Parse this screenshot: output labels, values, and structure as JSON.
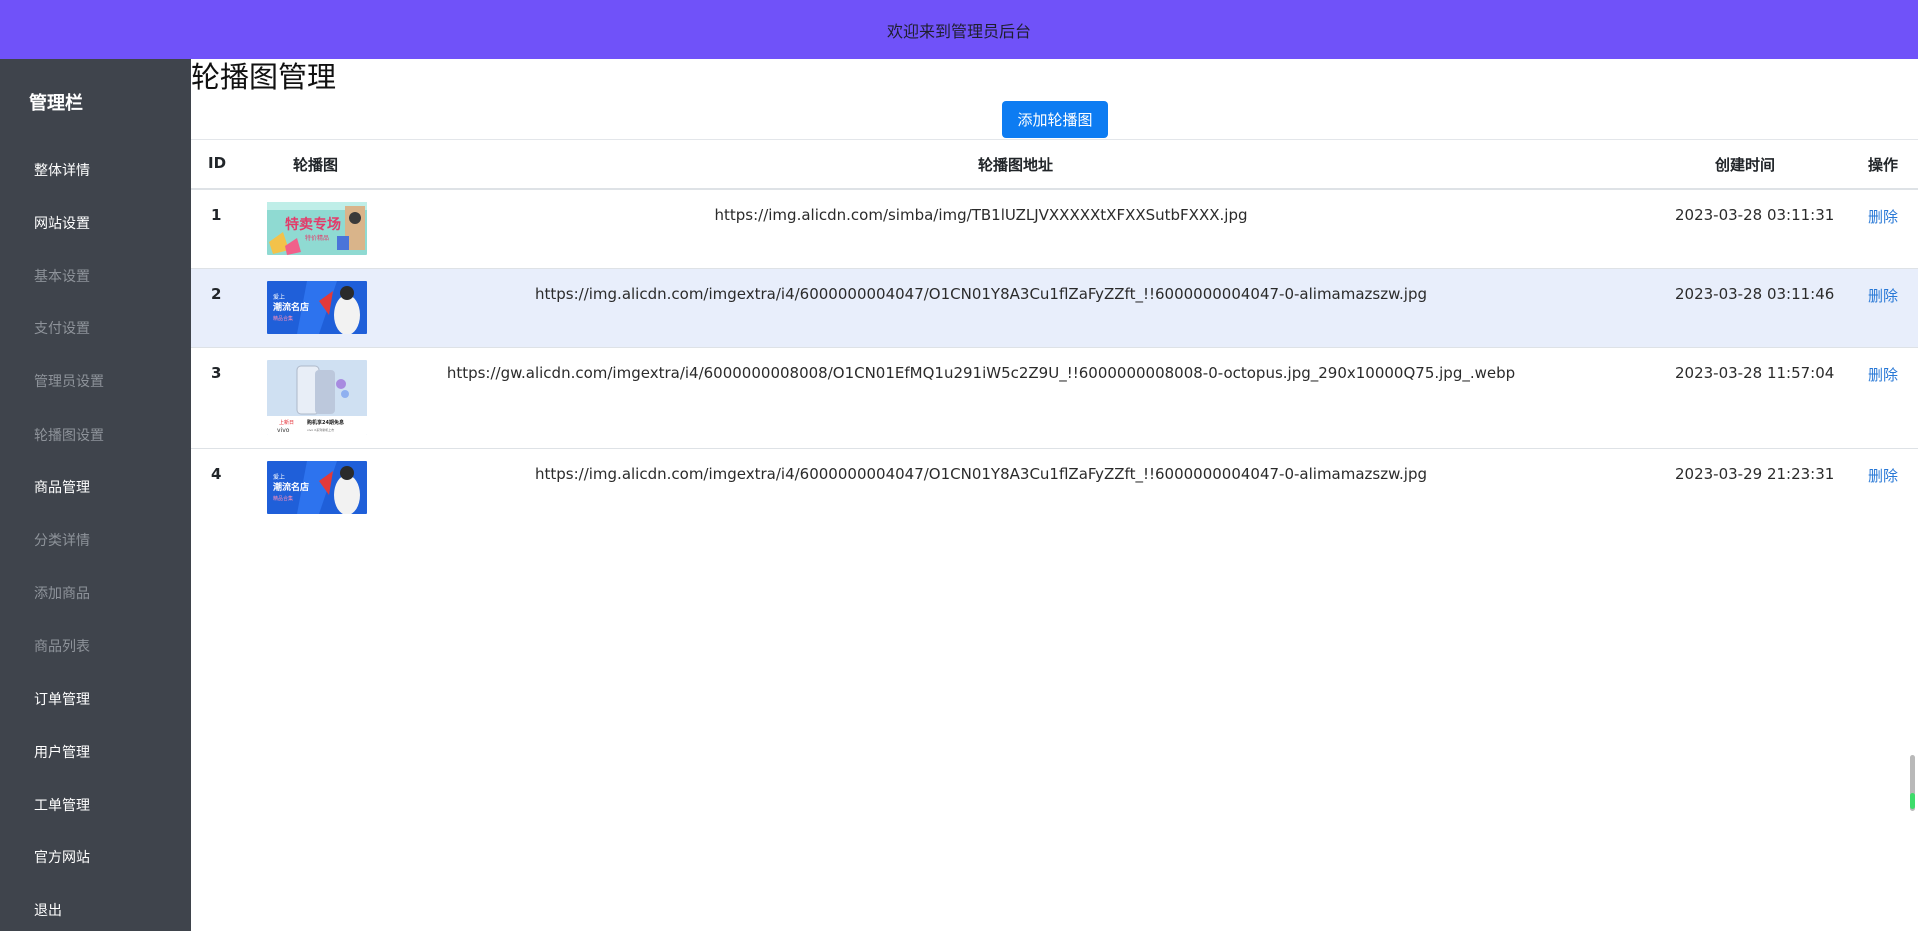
{
  "header": {
    "welcome": "欢迎来到管理员后台"
  },
  "sidebar": {
    "title": "管理栏",
    "items": [
      {
        "label": "整体详情",
        "kind": "primary"
      },
      {
        "label": "网站设置",
        "kind": "primary"
      },
      {
        "label": "基本设置",
        "kind": "sub"
      },
      {
        "label": "支付设置",
        "kind": "sub"
      },
      {
        "label": "管理员设置",
        "kind": "sub"
      },
      {
        "label": "轮播图设置",
        "kind": "sub"
      },
      {
        "label": "商品管理",
        "kind": "primary"
      },
      {
        "label": "分类详情",
        "kind": "sub"
      },
      {
        "label": "添加商品",
        "kind": "sub"
      },
      {
        "label": "商品列表",
        "kind": "sub"
      },
      {
        "label": "订单管理",
        "kind": "primary"
      },
      {
        "label": "用户管理",
        "kind": "primary"
      },
      {
        "label": "工单管理",
        "kind": "primary"
      },
      {
        "label": "官方网站",
        "kind": "primary"
      },
      {
        "label": "退出",
        "kind": "primary"
      }
    ]
  },
  "main": {
    "title": "轮播图管理",
    "add_button": "添加轮播图",
    "table": {
      "headers": {
        "id": "ID",
        "image": "轮播图",
        "url": "轮播图地址",
        "created": "创建时间",
        "action": "操作"
      },
      "rows": [
        {
          "id": "1",
          "url": "https://img.alicdn.com/simba/img/TB1lUZLJVXXXXXtXFXXSutbFXXX.jpg",
          "created": "2023-03-28 03:11:31",
          "action": "删除",
          "thumb": {
            "main_text": "特卖专场",
            "sub_text": "特价精品"
          }
        },
        {
          "id": "2",
          "url": "https://img.alicdn.com/imgextra/i4/6000000004047/O1CN01Y8A3Cu1flZaFyZZft_!!6000000004047-0-alimamazszw.jpg",
          "created": "2023-03-28 03:11:46",
          "action": "删除",
          "thumb": {
            "line1": "爱上",
            "line2": "潮流名店",
            "line3": "精品合集"
          }
        },
        {
          "id": "3",
          "url": "https://gw.alicdn.com/imgextra/i4/6000000008008/O1CN01EfMQ1u291iW5c2Z9U_!!6000000008008-0-octopus.jpg_290x10000Q75.jpg_.webp",
          "created": "2023-03-28 11:57:04",
          "action": "删除",
          "thumb": {
            "tag": "上新日",
            "brand": "vivo",
            "promo": "购机享24期免息",
            "promo_sub": "vivo X系列新机上市"
          }
        },
        {
          "id": "4",
          "url": "https://img.alicdn.com/imgextra/i4/6000000004047/O1CN01Y8A3Cu1flZaFyZZft_!!6000000004047-0-alimamazszw.jpg",
          "created": "2023-03-29 21:23:31",
          "action": "删除",
          "thumb": {
            "line1": "爱上",
            "line2": "潮流名店",
            "line3": "精品合集"
          }
        }
      ]
    }
  },
  "colors": {
    "topbar": "#7052f9",
    "sidebar": "#3f444c",
    "primary_button": "#0d7cf2",
    "link": "#2878d6",
    "row_highlight": "#e8eefb"
  }
}
